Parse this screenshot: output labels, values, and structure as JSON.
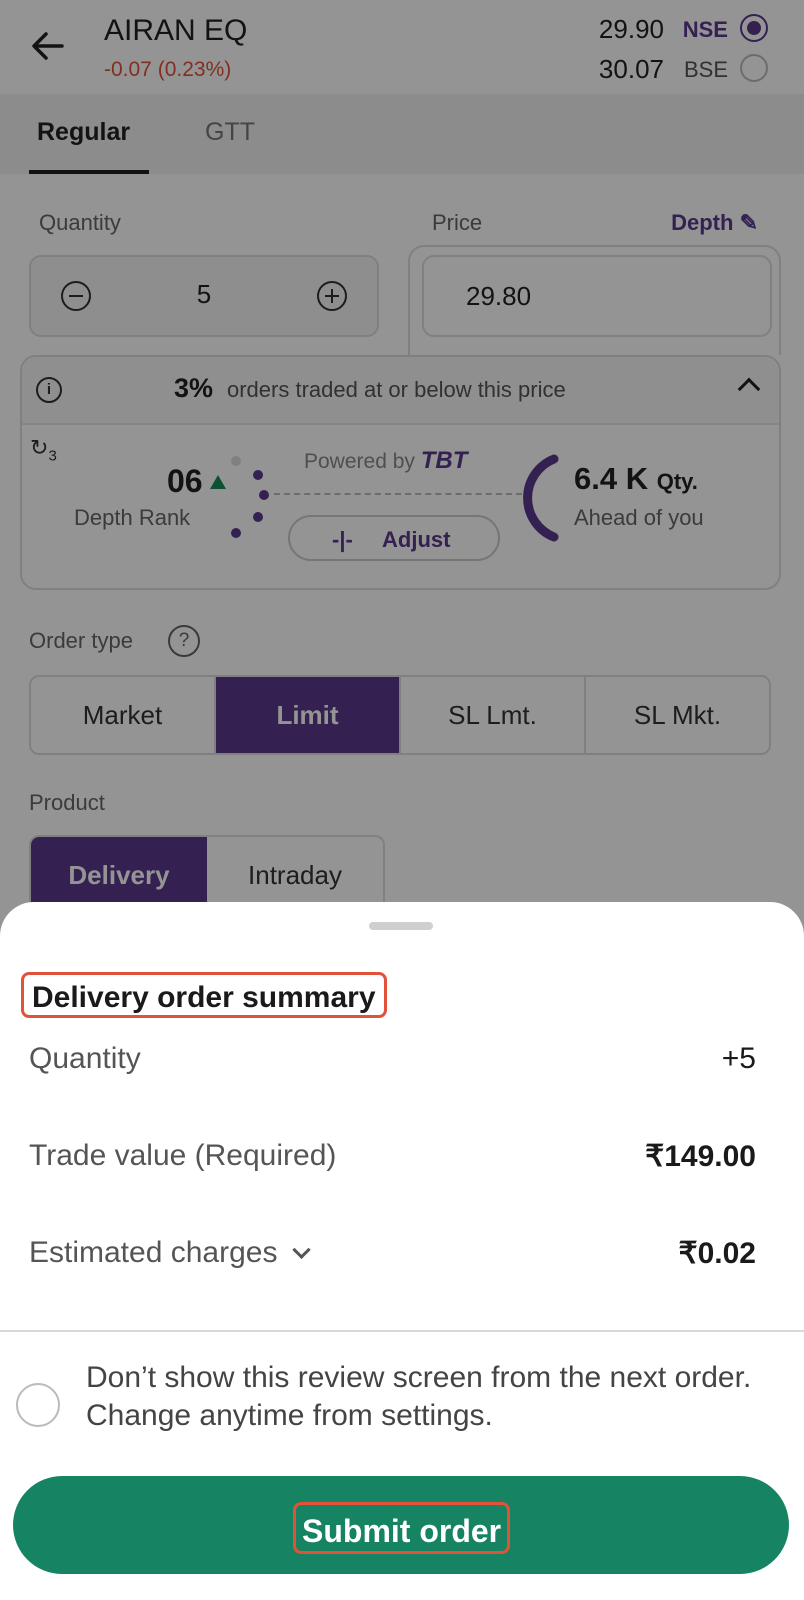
{
  "header": {
    "symbol": "AIRAN EQ",
    "change": "-0.07 (0.23%)",
    "exchanges": [
      {
        "price": "29.90",
        "name": "NSE",
        "selected": true
      },
      {
        "price": "30.07",
        "name": "BSE",
        "selected": false
      }
    ]
  },
  "tabs": [
    "Regular",
    "GTT"
  ],
  "order_form": {
    "quantity_label": "Quantity",
    "quantity_value": "5",
    "price_label": "Price",
    "depth_label": "Depth",
    "price_value": "29.80",
    "tbt": {
      "percent": "3%",
      "text": "orders traded at or below this price",
      "refresh_count": "3",
      "rank_value": "06",
      "rank_label": "Depth Rank",
      "powered_by": "Powered by",
      "brand": "TBT",
      "adjust_label": "Adjust",
      "qty_ahead": "6.4 K",
      "qty_unit": "Qty.",
      "ahead_label": "Ahead of you"
    },
    "order_type_label": "Order type",
    "order_types": [
      "Market",
      "Limit",
      "SL Lmt.",
      "SL Mkt."
    ],
    "order_type_selected": "Limit",
    "product_label": "Product",
    "products": [
      "Delivery",
      "Intraday"
    ],
    "product_selected": "Delivery"
  },
  "summary": {
    "title": "Delivery order summary",
    "rows": [
      {
        "label": "Quantity",
        "value": "+5"
      },
      {
        "label": "Trade value (Required)",
        "value": "₹149.00"
      },
      {
        "label": "Estimated charges",
        "value": "₹0.02"
      }
    ],
    "checkbox_text": "Don’t show this review screen from the next order. Change anytime from settings.",
    "submit_label": "Submit order"
  },
  "colors": {
    "accent_purple": "#5b3a8c",
    "submit_green": "#168462",
    "negative_red": "#e0523a",
    "highlight_box": "#e0523a"
  }
}
